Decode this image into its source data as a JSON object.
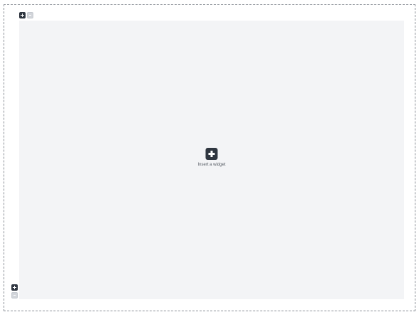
{
  "layout_editor": {
    "top_controls": {
      "add_icon": "plus-square-icon",
      "remove_icon": "minus-square-icon"
    },
    "insert_widget": {
      "icon": "plus-square-icon",
      "label": "Insert a widget"
    },
    "bottom_controls": {
      "add_icon": "plus-square-icon",
      "remove_icon": "minus-square-icon"
    }
  },
  "colors": {
    "canvas_background": "#f3f4f6",
    "icon_dark": "#2f3640",
    "icon_disabled": "#d2d5da",
    "frame_border": "#8a8f96"
  }
}
